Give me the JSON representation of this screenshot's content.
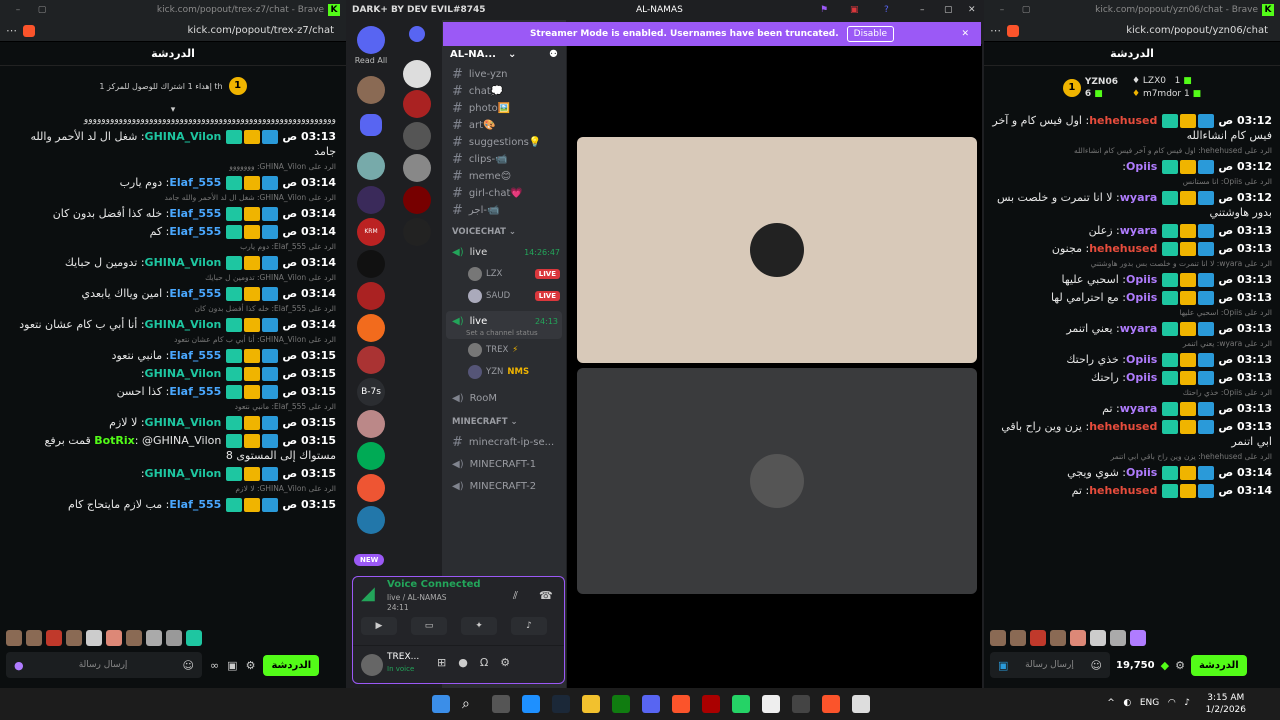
{
  "left_window": {
    "title": "kick.com/popout/trex-z7/chat - Brave",
    "url": "kick.com/popout/trex-z7/chat",
    "chat_header": "الدردشة",
    "goal_text": "إهداء 1 اشتراك للوصول للمركز 1 th",
    "goal_count": "1",
    "messages": [
      {
        "time": "03:13 ص",
        "user": "GHINA_Vilon",
        "color": "#1ec6a1",
        "text": "شغل ال لد الأحمر والله جامد",
        "reply": ""
      },
      {
        "time": "03:14 ص",
        "user": "Elaf_555",
        "color": "#4aa8ff",
        "text": "دوم يارب",
        "reply": "الرد على GHINA_Vilon: ﻭﻭﻭﻭﻭﻭﻭ"
      },
      {
        "time": "03:14 ص",
        "user": "Elaf_555",
        "color": "#4aa8ff",
        "text": "خله كذا أفضل بدون كان",
        "reply": "الرد على GHINA_Vilon: شغل ال لد الأحمر والله جامد"
      },
      {
        "time": "03:14 ص",
        "user": "Elaf_555",
        "color": "#4aa8ff",
        "text": "كم",
        "reply": ""
      },
      {
        "time": "03:14 ص",
        "user": "GHINA_Vilon",
        "color": "#1ec6a1",
        "text": "تدومين ل حبايك",
        "reply": "الرد على Elaf_555: دوم يارب"
      },
      {
        "time": "03:14 ص",
        "user": "Elaf_555",
        "color": "#4aa8ff",
        "text": "امين ويااك يابعدي",
        "reply": "الرد على GHINA_Vilon: تدومين ل حبايك"
      },
      {
        "time": "03:14 ص",
        "user": "GHINA_Vilon",
        "color": "#1ec6a1",
        "text": "أنا أبي ب كام عشان نتعود",
        "reply": "الرد على Elaf_555: خله كذا أفضل بدون كان"
      },
      {
        "time": "03:15 ص",
        "user": "Elaf_555",
        "color": "#4aa8ff",
        "text": "مانبي نتعود",
        "reply": "الرد على GHINA_Vilon: أنا أبي ب كام عشان نتعود"
      },
      {
        "time": "03:15 ص",
        "user": "GHINA_Vilon",
        "color": "#1ec6a1",
        "text": "",
        "reply": ""
      },
      {
        "time": "03:15 ص",
        "user": "Elaf_555",
        "color": "#4aa8ff",
        "text": "كذا احسن",
        "reply": ""
      },
      {
        "time": "03:15 ص",
        "user": "GHINA_Vilon",
        "color": "#1ec6a1",
        "text": "لا لازم",
        "reply": "الرد على Elaf_555: مانبي نتعود"
      },
      {
        "time": "03:15 ص",
        "user": "BotRix",
        "color": "#53fc18",
        "text": "@GHINA_Vilon قمت برفع مستواك إلى المستوى 8",
        "reply": ""
      },
      {
        "time": "03:15 ص",
        "user": "GHINA_Vilon",
        "color": "#1ec6a1",
        "text": "",
        "reply": ""
      },
      {
        "time": "03:15 ص",
        "user": "Elaf_555",
        "color": "#4aa8ff",
        "text": "مب لازم مايتحاج كام",
        "reply": "الرد على GHINA_Vilon: لا لازم"
      }
    ],
    "input_placeholder": "إرسال رسالة",
    "send_label": "الدردشة"
  },
  "discord": {
    "title_left": "DARK+ BY DEV EVIL#8745",
    "title_center": "AL-NAMAS",
    "read_all": "Read All",
    "new_badge": "NEW",
    "server_name": "AL-NA...",
    "banner_text": "Streamer Mode is enabled. Usernames have been truncated.",
    "banner_button": "Disable",
    "text_channels": [
      "live-yzn",
      "chat💭",
      "photo🖼️",
      "art🎨",
      "suggestions💡",
      "clips-📹",
      "meme😊",
      "girl-chat💗",
      "اجر-📹"
    ],
    "voice_category": "VOICECHAT",
    "voice1": {
      "name": "live",
      "time": "14:26:47",
      "users": [
        {
          "name": "LZX",
          "live": "LIVE"
        },
        {
          "name": "SAUD",
          "live": "LIVE"
        }
      ]
    },
    "voice2": {
      "name": "live",
      "time": "24:13",
      "status": "Set a channel status",
      "users": [
        {
          "name": "TREX",
          "tag": ""
        },
        {
          "name": "YZN",
          "tag": "NMS"
        }
      ]
    },
    "room": "RooM",
    "minecraft_category": "MINECRAFT",
    "minecraft_channels": [
      "minecraft-ip-se...",
      "MINECRAFT-1",
      "MINECRAFT-2"
    ],
    "voice_connected": "Voice Connected",
    "voice_path": "live / AL-NAMAS",
    "voice_time": "24:11",
    "me_name": "TREX...",
    "me_status": "In voice",
    "server_labels": [
      "KRM",
      "B-7s"
    ]
  },
  "right_window": {
    "title": "kick.com/popout/yzn06/chat - Brave",
    "url": "kick.com/popout/yzn06/chat",
    "chat_header": "الدردشة",
    "leaders": [
      {
        "name": "YZN06",
        "count": "6"
      },
      {
        "name": "LZX0",
        "count": "1"
      },
      {
        "name": "m7mdor",
        "count": "1"
      }
    ],
    "goal_count": "1",
    "messages": [
      {
        "time": "03:12 ص",
        "user": "hehehused",
        "color": "#e74c3c",
        "text": "اول فيس كام و آخر فيس كام انشاءالله",
        "reply": ""
      },
      {
        "time": "03:12 ص",
        "user": "Opiis",
        "color": "#b07cff",
        "text": "",
        "reply": "الرد على hehehused: اول فيس كام و آخر فيس كام انشاءالله"
      },
      {
        "time": "03:12 ص",
        "user": "wyara",
        "color": "#b07cff",
        "text": "لا انا تنمرت و خلصت بس بدور هاوشتني",
        "reply": "الرد على Opiis: انا مستانس"
      },
      {
        "time": "03:13 ص",
        "user": "wyara",
        "color": "#b07cff",
        "text": "زعلن",
        "reply": ""
      },
      {
        "time": "03:13 ص",
        "user": "hehehused",
        "color": "#e74c3c",
        "text": "مجنون",
        "reply": ""
      },
      {
        "time": "03:13 ص",
        "user": "Opiis",
        "color": "#b07cff",
        "text": "اسحبي عليها",
        "reply": "الرد على wyara: لا انا تنمرت و خلصت بس بدور هاوشتني"
      },
      {
        "time": "03:13 ص",
        "user": "Opiis",
        "color": "#b07cff",
        "text": "مع احترامي لها",
        "reply": ""
      },
      {
        "time": "03:13 ص",
        "user": "wyara",
        "color": "#b07cff",
        "text": "يعني اتنمر",
        "reply": "الرد على Opiis: اسحبي عليها"
      },
      {
        "time": "03:13 ص",
        "user": "Opiis",
        "color": "#b07cff",
        "text": "خذي راحتك",
        "reply": "الرد على wyara: يعني اتنمر"
      },
      {
        "time": "03:13 ص",
        "user": "Opiis",
        "color": "#b07cff",
        "text": "راحتك",
        "reply": ""
      },
      {
        "time": "03:13 ص",
        "user": "wyara",
        "color": "#b07cff",
        "text": "تم",
        "reply": "الرد على Opiis: خذي راحتك"
      },
      {
        "time": "03:13 ص",
        "user": "hehehused",
        "color": "#e74c3c",
        "text": "يزن وين راح باقي ابي اتنمر",
        "reply": ""
      },
      {
        "time": "03:14 ص",
        "user": "Opiis",
        "color": "#b07cff",
        "text": "شوي ويجي",
        "reply": "الرد على hehehused: يزن وين راح باقي ابي اتنمر"
      },
      {
        "time": "03:14 ص",
        "user": "hehehused",
        "color": "#e74c3c",
        "text": "تم",
        "reply": ""
      }
    ],
    "input_placeholder": "إرسال رسالة",
    "kicks": "19,750",
    "send_label": "الدردشة"
  },
  "taskbar": {
    "lang": "ENG",
    "time": "3:15 AM",
    "date": "1/2/2026"
  }
}
